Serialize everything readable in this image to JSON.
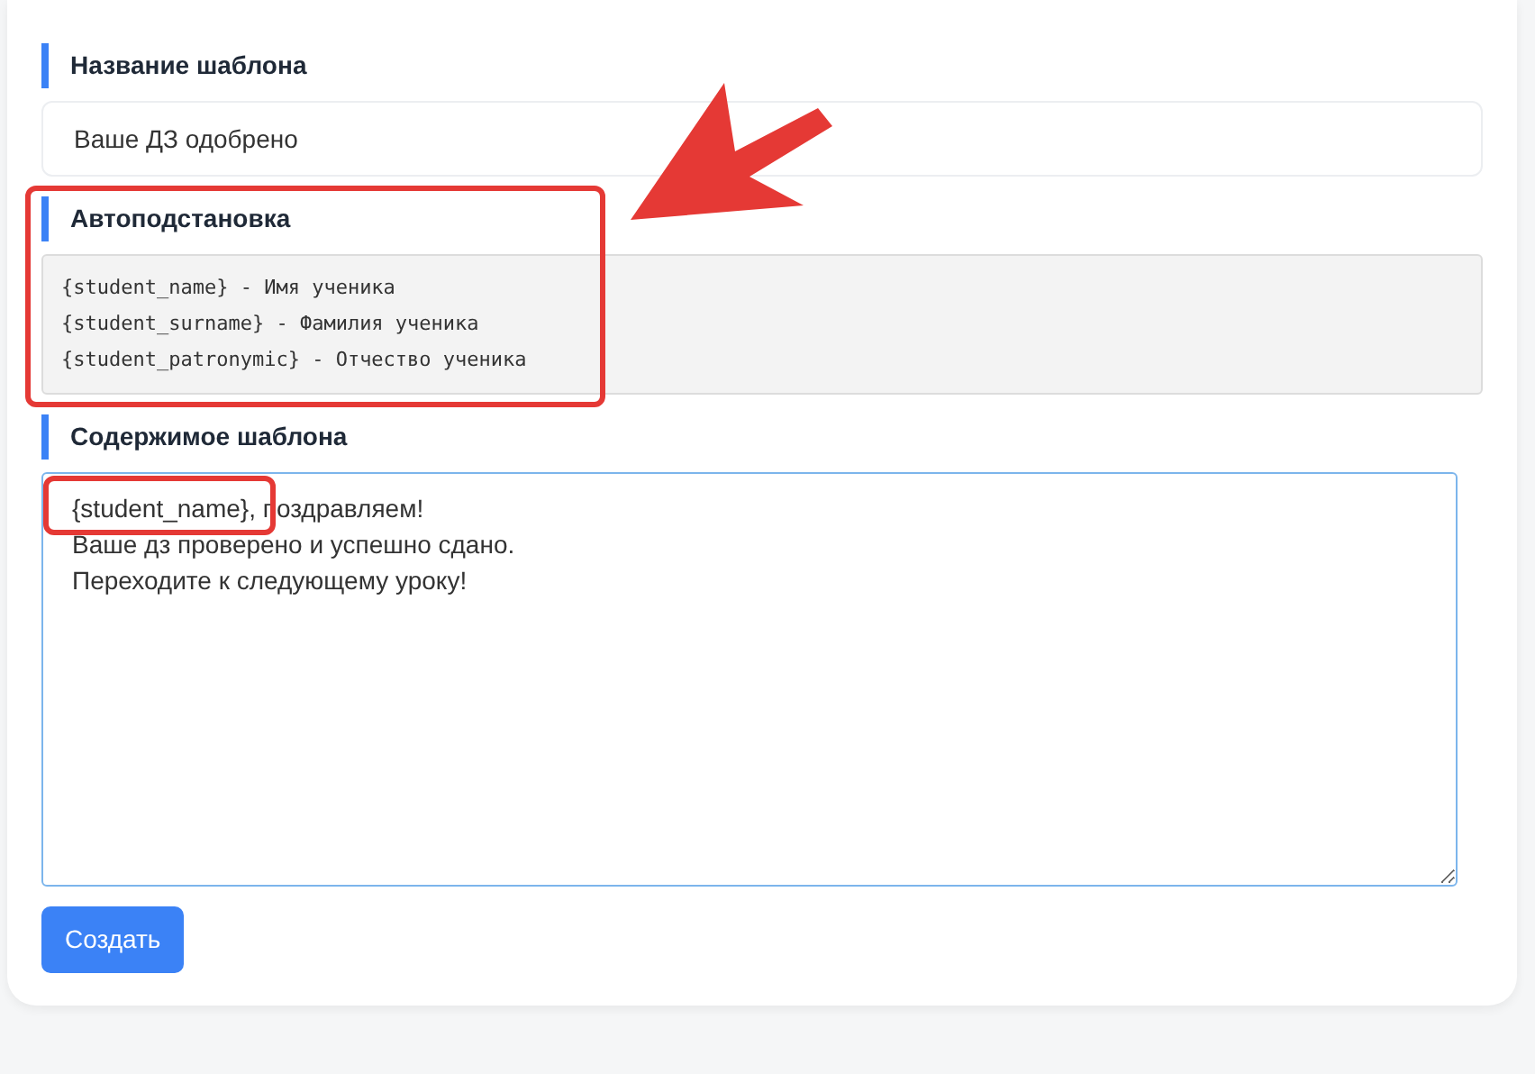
{
  "fields": [
    {
      "kind": "input",
      "label": "Название шаблона",
      "value": "Ваше ДЗ одобрено"
    },
    {
      "kind": "code",
      "label": "Автоподстановка",
      "lines": [
        "{student_name} - Имя ученика",
        "{student_surname} - Фамилия ученика",
        "{student_patronymic} - Отчество ученика"
      ]
    },
    {
      "kind": "textarea",
      "label": "Содержимое шаблона",
      "lines": [
        "{student_name}, поздравляем!",
        "Ваше дз проверено и успешно сдано.",
        "Переходите к следующему уроку!"
      ]
    }
  ],
  "button": "Создать"
}
